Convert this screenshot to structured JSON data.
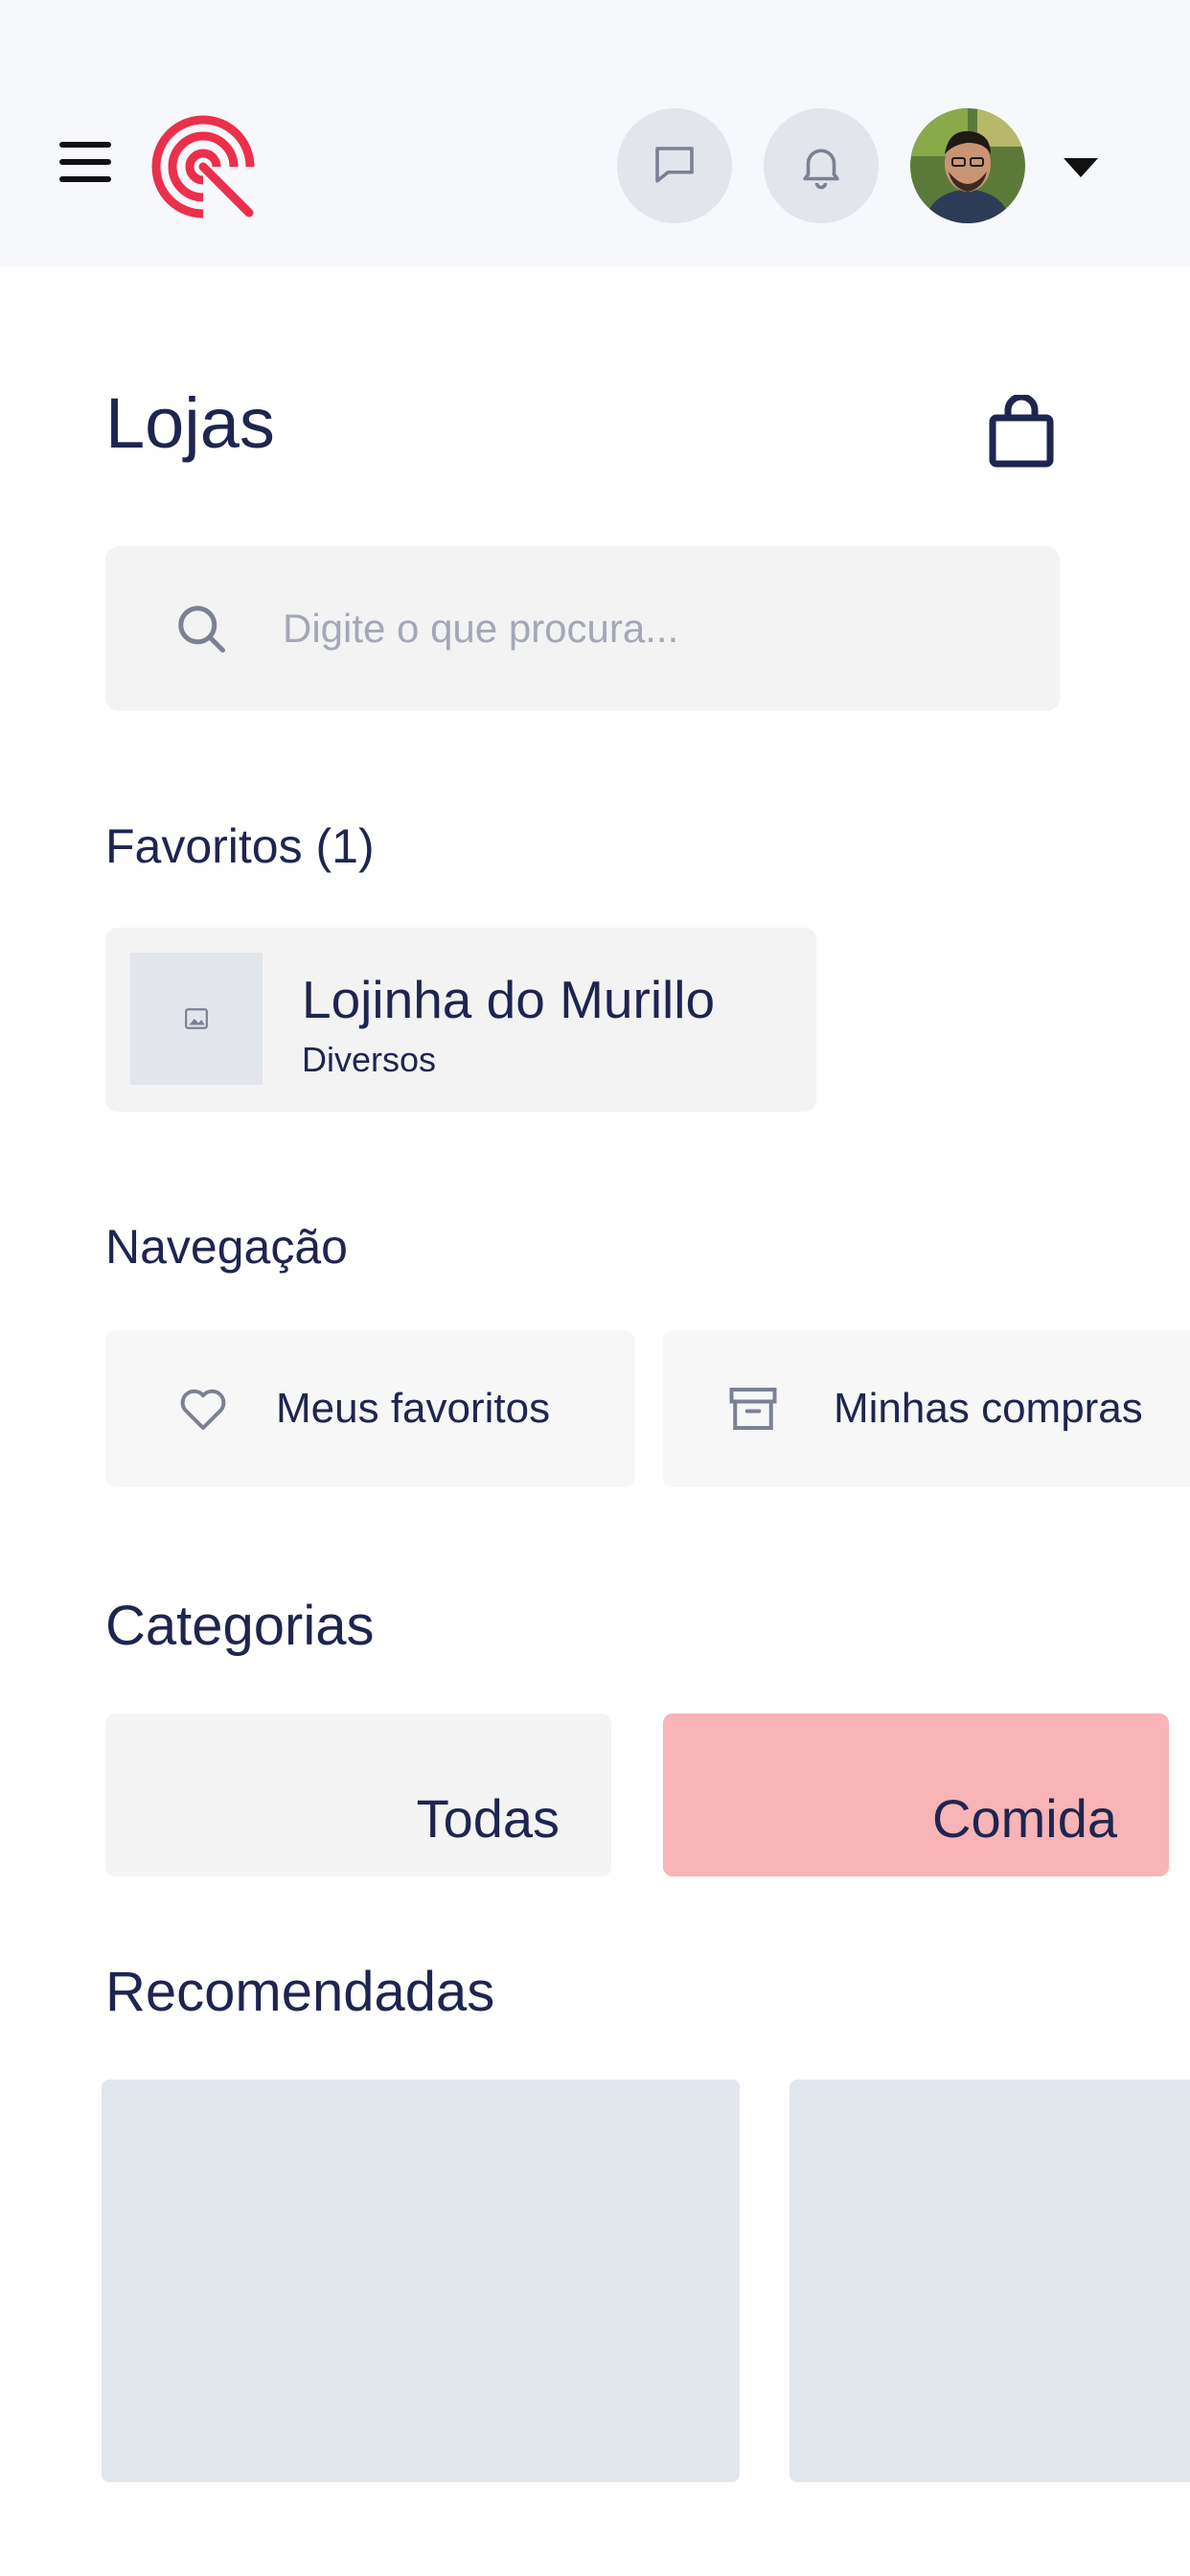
{
  "header": {
    "menu_icon": "hamburger-menu-icon",
    "logo_icon": "brand-logo-icon",
    "chat_icon": "chat-bubble-icon",
    "bell_icon": "bell-icon",
    "avatar_icon": "user-avatar",
    "caret_icon": "caret-down-icon"
  },
  "page": {
    "title": "Lojas",
    "cart_icon": "shopping-bag-icon"
  },
  "search": {
    "placeholder": "Digite o que procura...",
    "value": "",
    "icon": "search-icon"
  },
  "favorites": {
    "title": "Favoritos (1)",
    "items": [
      {
        "name": "Lojinha do Murillo",
        "category": "Diversos",
        "image_icon": "image-placeholder-icon"
      }
    ]
  },
  "navigation": {
    "title": "Navegação",
    "items": [
      {
        "label": "Meus favoritos",
        "icon": "heart-icon"
      },
      {
        "label": "Minhas compras",
        "icon": "archive-box-icon"
      }
    ]
  },
  "categories": {
    "title": "Categorias",
    "items": [
      {
        "label": "Todas",
        "color": "#f4f4f4"
      },
      {
        "label": "Comida",
        "color": "#f8b4b6"
      }
    ]
  },
  "recommended": {
    "title": "Recomendadas"
  },
  "colors": {
    "brand": "#ec2f4b",
    "text": "#1e2550",
    "header_bg": "#f7f8fb",
    "muted": "#a3a8b8"
  }
}
